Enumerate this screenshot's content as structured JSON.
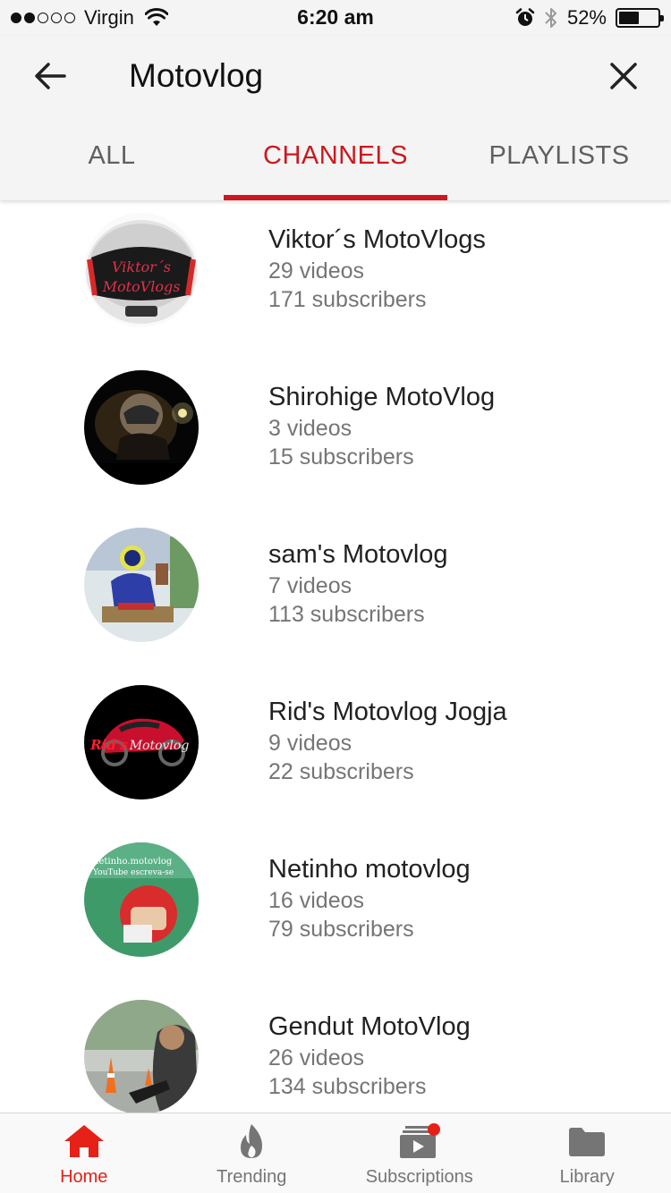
{
  "status_bar": {
    "carrier": "Virgin",
    "time": "6:20 am",
    "battery_percent": "52%",
    "battery_level": 0.52,
    "signal_bars_filled": 2,
    "signal_bars_total": 5
  },
  "search": {
    "query": "Motovlog"
  },
  "tabs": [
    {
      "label": "ALL",
      "active": false
    },
    {
      "label": "CHANNELS",
      "active": true
    },
    {
      "label": "PLAYLISTS",
      "active": false
    }
  ],
  "channels": [
    {
      "name": "Viktor´s MotoVlogs",
      "videos": "29 videos",
      "subscribers": "171 subscribers",
      "avatar_text_1": "Viktor´s",
      "avatar_text_2": "MotoVlogs"
    },
    {
      "name": "Shirohige MotoVlog",
      "videos": "3 videos",
      "subscribers": "15 subscribers"
    },
    {
      "name": "sam's Motovlog",
      "videos": "7 videos",
      "subscribers": "113 subscribers"
    },
    {
      "name": "Rid's Motovlog Jogja",
      "videos": "9 videos",
      "subscribers": "22 subscribers",
      "avatar_text_1": "Rid's",
      "avatar_text_2": "Motovlog"
    },
    {
      "name": "Netinho motovlog",
      "videos": "16 videos",
      "subscribers": "79 subscribers",
      "avatar_text_1": "netinho.motovlog",
      "avatar_text_2": "YouTube escreva-se"
    },
    {
      "name": "Gendut MotoVlog",
      "videos": "26 videos",
      "subscribers": "134 subscribers"
    }
  ],
  "bottom_nav": [
    {
      "label": "Home",
      "icon": "home-icon",
      "active": true
    },
    {
      "label": "Trending",
      "icon": "flame-icon",
      "active": false
    },
    {
      "label": "Subscriptions",
      "icon": "subscriptions-icon",
      "active": false
    },
    {
      "label": "Library",
      "icon": "folder-icon",
      "active": false
    }
  ],
  "colors": {
    "accent": "#cc181e",
    "nav_active": "#e62117",
    "header_bg": "#f4f4f4",
    "secondary_text": "#757575"
  }
}
